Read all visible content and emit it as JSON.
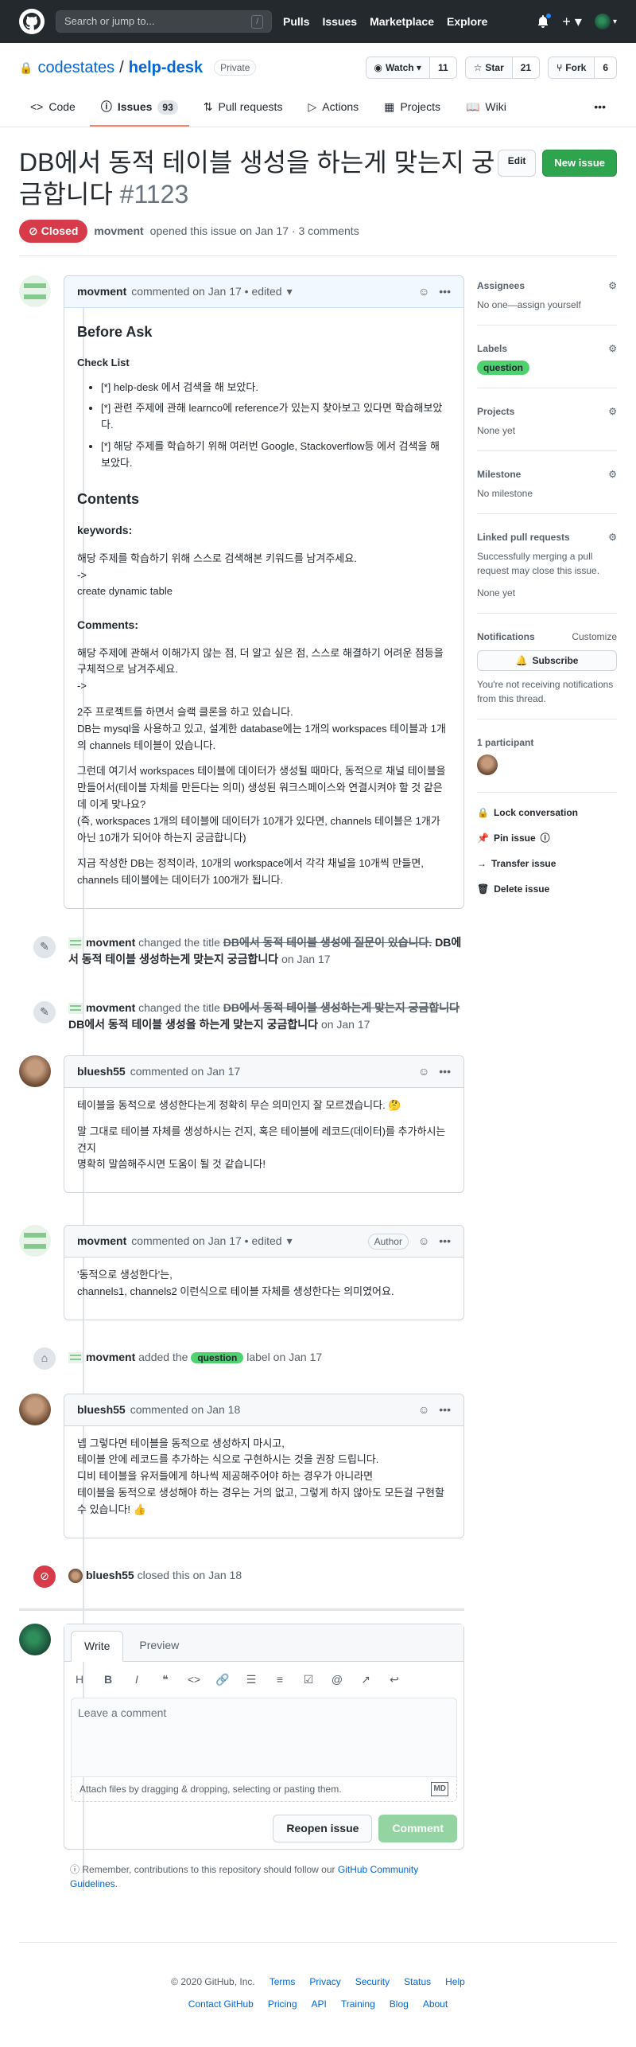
{
  "header": {
    "search_placeholder": "Search or jump to...",
    "slash": "/",
    "nav": [
      "Pulls",
      "Issues",
      "Marketplace",
      "Explore"
    ]
  },
  "repo": {
    "owner": "codestates",
    "sep": "/",
    "name": "help-desk",
    "visibility": "Private",
    "watch": "Watch",
    "watch_count": "11",
    "star": "Star",
    "star_count": "21",
    "fork": "Fork",
    "fork_count": "6"
  },
  "tabs": [
    {
      "label": "Code"
    },
    {
      "label": "Issues",
      "count": "93"
    },
    {
      "label": "Pull requests"
    },
    {
      "label": "Actions"
    },
    {
      "label": "Projects"
    },
    {
      "label": "Wiki"
    }
  ],
  "issue": {
    "title": "DB에서 동적 테이블 생성을 하는게 맞는지 궁금합니다",
    "number": "#1123",
    "edit": "Edit",
    "new_issue": "New issue",
    "state": "Closed",
    "author": "movment",
    "meta": "opened this issue on Jan 17 · 3 comments"
  },
  "c1": {
    "author": "movment",
    "meta": "commented on Jan 17 • edited",
    "h_before": "Before Ask",
    "h_check": "Check List",
    "checks": [
      "[*] help-desk 에서 검색을 해 보았다.",
      "[*] 관련 주제에 관해 learnco에 reference가 있는지 찾아보고 있다면 학습해보았다.",
      "[*] 해당 주제를 학습하기 위해 여러번 Google, Stackoverflow등 에서 검색을 해 보았다."
    ],
    "h_contents": "Contents",
    "h_keywords": "keywords:",
    "kw1": "해당 주제를 학습하기 위해 스스로 검색해본 키워드를 남겨주세요.",
    "kw2": "->",
    "kw3": "create dynamic table",
    "h_comments": "Comments:",
    "cm1": "해당 주제에 관해서 이해가지 않는 점, 더 알고 싶은 점, 스스로 해결하기 어려운 점등을 구체적으로 남겨주세요.",
    "cm2": "->",
    "p1": "2주 프로젝트를 하면서 슬랙 클론을 하고 있습니다.",
    "p2": "DB는 mysql을 사용하고 있고, 설계한 database에는 1개의 workspaces 테이블과 1개의 channels 테이블이 있습니다.",
    "p3": "그런데 여기서 workspaces 테이블에 데이터가 생성될 때마다, 동적으로 채널 테이블을 만들어서(테이블 자체를 만든다는 의미) 생성된 워크스페이스와 연결시켜야 할 것 같은데 이게 맞나요?",
    "p4": "(즉, workspaces 1개의 테이블에 데이터가 10개가 있다면, channels 테이블은 1개가 아닌 10개가 되어야 하는지 궁금합니다)",
    "p5": "지금 작성한 DB는 정적이라, 10개의 workspace에서 각각 채널을 10개씩 만들면, channels 테이블에는 데이터가 100개가 됩니다."
  },
  "ev1": {
    "actor": "movment",
    "action": "changed the title",
    "old": "DB에서 동적 테이블 생성에 질문이 있습니다.",
    "new": "DB에서 동적 테이블 생성하는게 맞는지 궁금합니다",
    "time": "on Jan 17"
  },
  "ev2": {
    "actor": "movment",
    "action": "changed the title",
    "old": "DB에서 동적 테이블 생성하는게 맞는지 궁금합니다",
    "new": "DB에서 동적 테이블 생성을 하는게 맞는지 궁금합니다",
    "time": "on Jan 17"
  },
  "c2": {
    "author": "bluesh55",
    "meta": "commented on Jan 17",
    "l1": "테이블을 동적으로 생성한다는게 정확히 무슨 의미인지 잘 모르겠습니다. 🤔",
    "l2": "말 그대로 테이블 자체를 생성하시는 건지, 혹은 테이블에 레코드(데이터)를 추가하시는 건지",
    "l3": "명확히 말씀해주시면 도움이 될 것 같습니다!"
  },
  "c3": {
    "author": "movment",
    "meta": "commented on Jan 17 • edited",
    "badge": "Author",
    "l1": "'동적으로 생성한다'는,",
    "l2": "channels1, channels2 이런식으로 테이블 자체를 생성한다는 의미였어요."
  },
  "ev3": {
    "actor": "movment",
    "action": "added the",
    "label": "question",
    "tail": "label on Jan 17"
  },
  "c4": {
    "author": "bluesh55",
    "meta": "commented on Jan 18",
    "l1": "넵 그렇다면 테이블을 동적으로 생성하지 마시고,",
    "l2": "테이블 안에 레코드를 추가하는 식으로 구현하시는 것을 권장 드립니다.",
    "l3": "디비 테이블을 유저들에게 하나씩 제공해주어야 하는 경우가 아니라면",
    "l4": "테이블을 동적으로 생성해야 하는 경우는 거의 없고, 그렇게 하지 않아도 모든걸 구현할 수 있습니다! 👍"
  },
  "ev4": {
    "actor": "bluesh55",
    "action": "closed this on Jan 18"
  },
  "editor": {
    "write": "Write",
    "preview": "Preview",
    "placeholder": "Leave a comment",
    "attach": "Attach files by dragging & dropping, selecting or pasting them.",
    "md": "MD",
    "reopen": "Reopen issue",
    "comment": "Comment",
    "remind_pre": "Remember, contributions to this repository should follow our ",
    "remind_link": "GitHub Community Guidelines",
    "remind_post": "."
  },
  "sidebar": {
    "assignees": "Assignees",
    "assignees_val": "No one—assign yourself",
    "labels": "Labels",
    "label": "question",
    "projects": "Projects",
    "projects_val": "None yet",
    "milestone": "Milestone",
    "milestone_val": "No milestone",
    "linked": "Linked pull requests",
    "linked_desc": "Successfully merging a pull request may close this issue.",
    "linked_val": "None yet",
    "notif": "Notifications",
    "customize": "Customize",
    "subscribe": "Subscribe",
    "notif_desc": "You're not receiving notifications from this thread.",
    "participants": "1 participant",
    "lock": "Lock conversation",
    "pin": "Pin issue",
    "transfer": "Transfer issue",
    "delete": "Delete issue"
  },
  "footer": {
    "copy": "© 2020 GitHub, Inc.",
    "row1": [
      "Terms",
      "Privacy",
      "Security",
      "Status",
      "Help"
    ],
    "row2": [
      "Contact GitHub",
      "Pricing",
      "API",
      "Training",
      "Blog",
      "About"
    ]
  }
}
